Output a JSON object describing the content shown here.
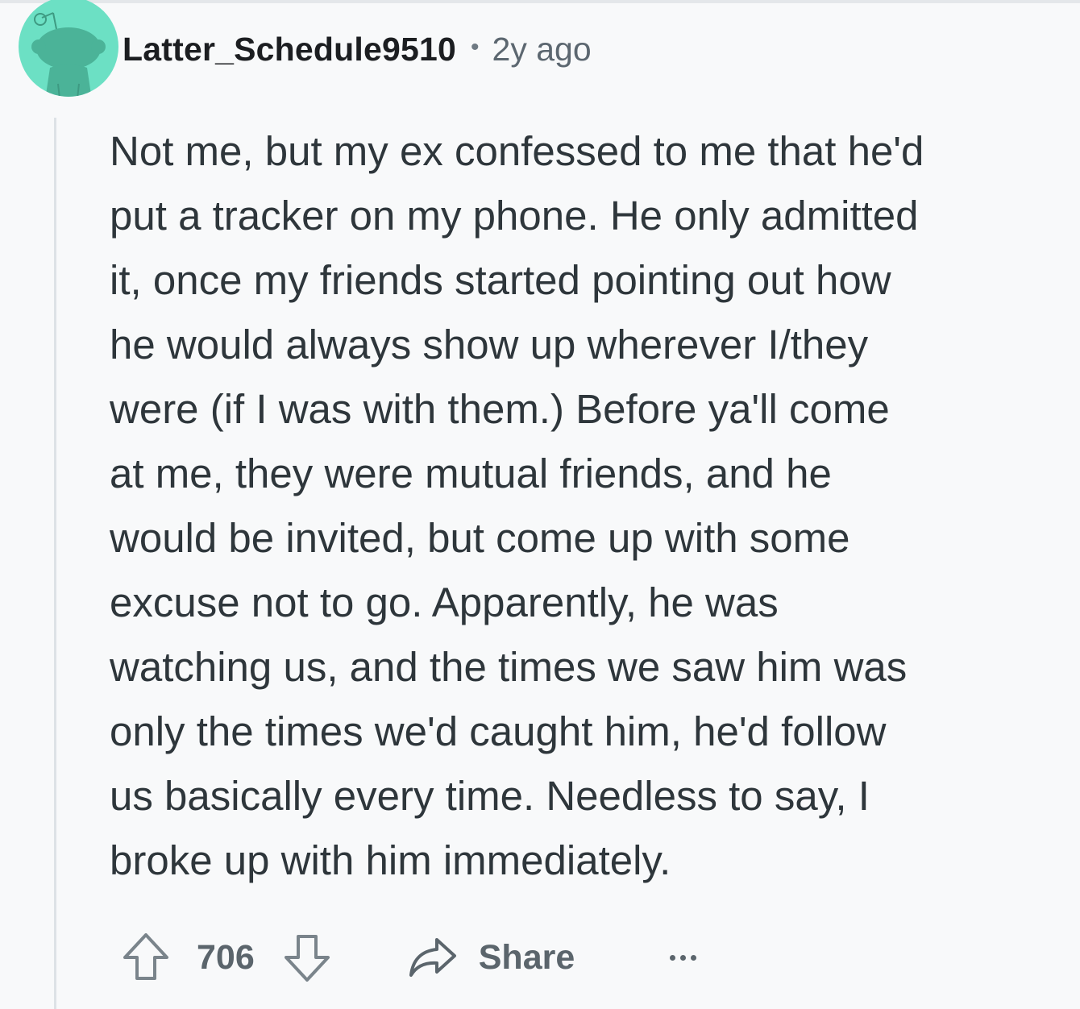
{
  "comment": {
    "author": "Latter_Schedule9510",
    "separator": "•",
    "age": "2y ago",
    "body": "Not me, but my ex confessed to me that he'd\nput a tracker on my phone. He only admitted\nit, once my friends started pointing out how\nhe would always show up wherever I/they\nwere (if I was with them.) Before ya'll come\nat me, they were mutual friends, and he\nwould be invited, but come up with some\nexcuse not to go. Apparently, he was\nwatching us, and the times we saw him was\nonly the times we'd caught him, he'd follow\nus basically every time. Needless to say, I\nbroke up with him immediately."
  },
  "actions": {
    "upvote_icon": "arrow-up-icon",
    "vote_count": "706",
    "downvote_icon": "arrow-down-icon",
    "share_icon": "share-arrow-icon",
    "share_label": "Share",
    "more_icon": "ellipsis-icon"
  },
  "colors": {
    "avatar_bg": "#6ce0c4",
    "avatar_figure": "#4bb398",
    "text": "#2e363b",
    "muted": "#5b656c",
    "thread_line": "#dde2e6",
    "background": "#f8f9fa"
  }
}
